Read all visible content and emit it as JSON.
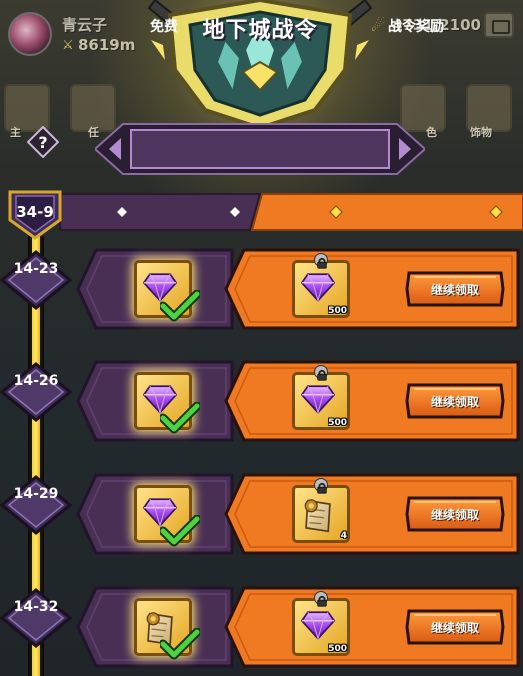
{
  "player": {
    "name": "青云子",
    "power": "8619m"
  },
  "energy": {
    "value": "4731/2100"
  },
  "side_buttons": [
    "主",
    "任",
    "",
    "色",
    "饰物"
  ],
  "title": "地下城战令",
  "tabs": {
    "free": "免费",
    "paid": "战令奖励"
  },
  "current_level": "34-9",
  "claim_label": "继续领取",
  "rows": [
    {
      "level": "14-23",
      "free_reward": "gem",
      "paid_reward": "gem",
      "paid_count": "500"
    },
    {
      "level": "14-26",
      "free_reward": "gem",
      "paid_reward": "gem",
      "paid_count": "500"
    },
    {
      "level": "14-29",
      "free_reward": "gem",
      "paid_reward": "scroll",
      "paid_count": "4"
    },
    {
      "level": "14-32",
      "free_reward": "scroll",
      "paid_reward": "gem",
      "paid_count": "500"
    }
  ],
  "colors": {
    "free_panel": "#4a2f55",
    "paid_panel": "#f07a22",
    "gold_border": "#e8c23a",
    "gem": "#9b3fe0",
    "check": "#3fbf3a",
    "track": "#f5d130"
  },
  "icons": [
    "purple-gem-icon",
    "scroll-icon",
    "checkmark-icon",
    "lock-icon",
    "question-icon",
    "diamond-icon"
  ]
}
